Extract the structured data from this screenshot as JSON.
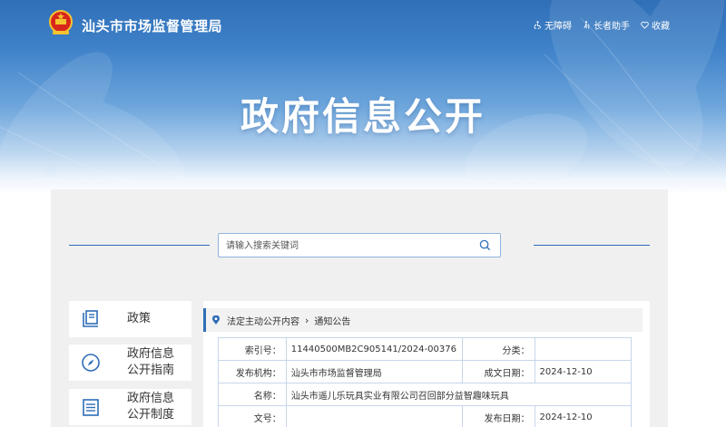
{
  "header": {
    "site_title": "汕头市市场监督管理局",
    "links": [
      {
        "label": "无障碍",
        "icon": "accessibility-icon"
      },
      {
        "label": "长者助手",
        "icon": "elder-assist-icon"
      },
      {
        "label": "收藏",
        "icon": "heart-icon"
      }
    ]
  },
  "banner": {
    "title": "政府信息公开"
  },
  "search": {
    "placeholder": "请输入搜索关键词",
    "value": ""
  },
  "sidebar": {
    "items": [
      {
        "label": "政策",
        "icon": "policy-book-icon"
      },
      {
        "label": "政府信息\n公开指南",
        "icon": "compass-icon"
      },
      {
        "label": "政府信息\n公开制度",
        "icon": "document-list-icon"
      }
    ]
  },
  "breadcrumb": {
    "items": [
      "法定主动公开内容",
      "通知公告"
    ]
  },
  "info": {
    "index_no_label": "索引号：",
    "index_no": "11440500MB2C905141/2024-00376",
    "category_label": "分类：",
    "category": "",
    "publisher_label": "发布机构：",
    "publisher": "汕头市市场监督管理局",
    "created_label": "成文日期：",
    "created": "2024-12-10",
    "name_label": "名称：",
    "name": "汕头市遥儿乐玩具实业有限公司召回部分益智趣味玩具",
    "doc_no_label": "文号：",
    "doc_no": "",
    "published_label": "发布日期：",
    "published": "2024-12-10"
  },
  "colors": {
    "banner_top": "#2f6fb8",
    "accent": "#2f6db8",
    "panel_bg": "#f0f0f0",
    "table_border": "#c6d6ea"
  }
}
